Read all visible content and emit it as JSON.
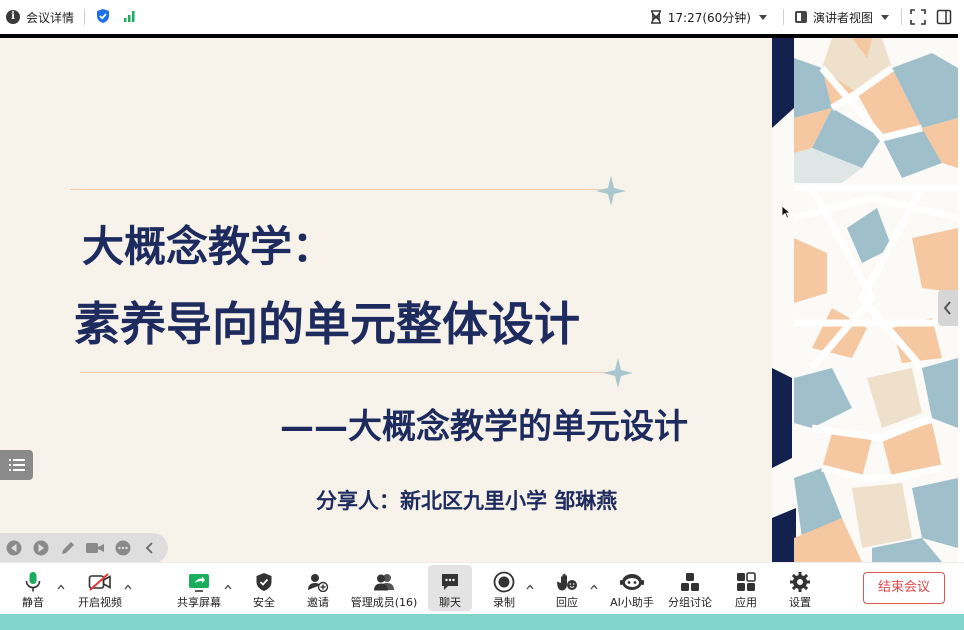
{
  "topbar": {
    "meeting_info_label": "会议详情",
    "timer": "17:27(60分钟)",
    "view_mode": "演讲者视图"
  },
  "slide": {
    "title_line1": "大概念教学：",
    "title_line2": "素养导向的单元整体设计",
    "subtitle": "——大概念教学的单元设计",
    "presenter": "分享人：新北区九里小学  邹琳燕"
  },
  "toolbar": {
    "mute": "静音",
    "start_video": "开启视频",
    "share_screen": "共享屏幕",
    "security": "安全",
    "invite": "邀请",
    "manage_participants": "管理成员(16)",
    "chat": "聊天",
    "record": "录制",
    "reactions": "回应",
    "ai_assistant": "AI小助手",
    "breakout": "分组讨论",
    "apps": "应用",
    "settings": "设置",
    "end_meeting": "结束会议"
  },
  "colors": {
    "slide_bg": "#f8f3ea",
    "title_text": "#1d2b5e",
    "accent_green": "#1aad5e",
    "accent_blue": "#1e6fe8",
    "end_red": "#e04848"
  }
}
